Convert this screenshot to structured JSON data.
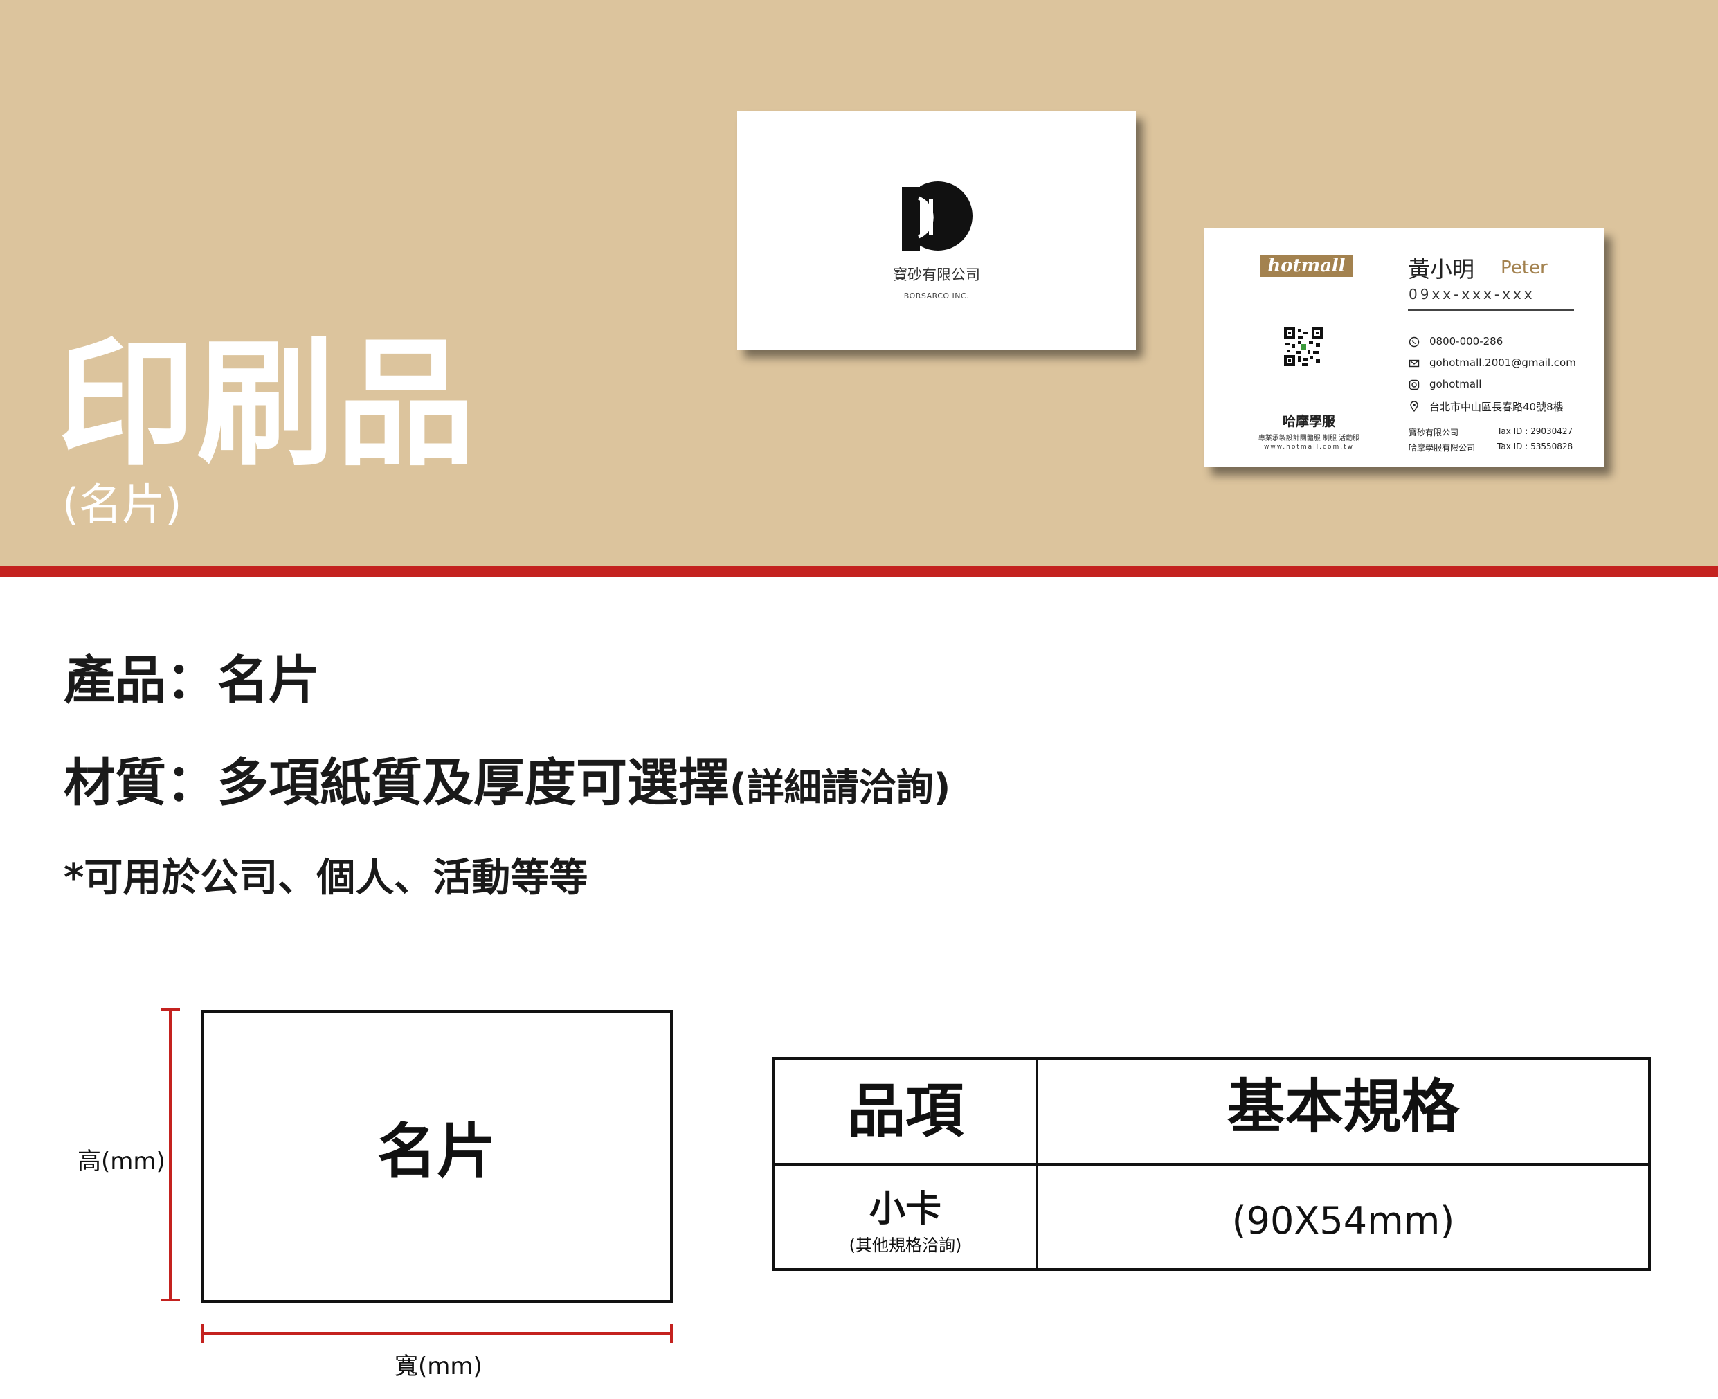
{
  "banner": {
    "title": "印刷品",
    "subtitle": "(名片)",
    "colors": {
      "background": "#dcc49d",
      "stripe": "#c4221f"
    }
  },
  "card_front": {
    "company_cn": "寶砂有限公司",
    "company_en": "BORSARCO INC."
  },
  "card_back": {
    "brand": "hotmall",
    "left_name": "哈摩學服",
    "left_tagline": "專業承製設計團體服 制服 活動服",
    "left_url": "www.hotmall.com.tw",
    "person_name": "黃小明",
    "person_en": "Peter",
    "phone": "09xx-xxx-xxx",
    "contacts": [
      {
        "icon": "whatsapp-icon",
        "text": "0800-000-286"
      },
      {
        "icon": "mail-icon",
        "text": "gohotmall.2001@gmail.com"
      },
      {
        "icon": "instagram-icon",
        "text": "gohotmall"
      },
      {
        "icon": "location-pin-icon",
        "text": "台北市中山區長春路40號8樓"
      }
    ],
    "companies": [
      {
        "name": "寶砂有限公司",
        "tax": "Tax ID : 29030427"
      },
      {
        "name": "哈摩學服有限公司",
        "tax": "Tax ID : 53550828"
      }
    ],
    "accent_color": "#a3824f"
  },
  "info": {
    "product": "產品：名片",
    "material": "材質：多項紙質及厚度可選擇",
    "material_note": "(詳細請洽詢)",
    "usage": "*可用於公司、個人、活動等等"
  },
  "diagram": {
    "box_label": "名片",
    "height_label": "高(mm)",
    "width_label": "寬(mm)"
  },
  "spec_table": {
    "headers": [
      "品項",
      "基本規格"
    ],
    "row": {
      "item": "小卡",
      "item_note": "(其他規格洽詢)",
      "spec": "(90X54mm)"
    }
  }
}
